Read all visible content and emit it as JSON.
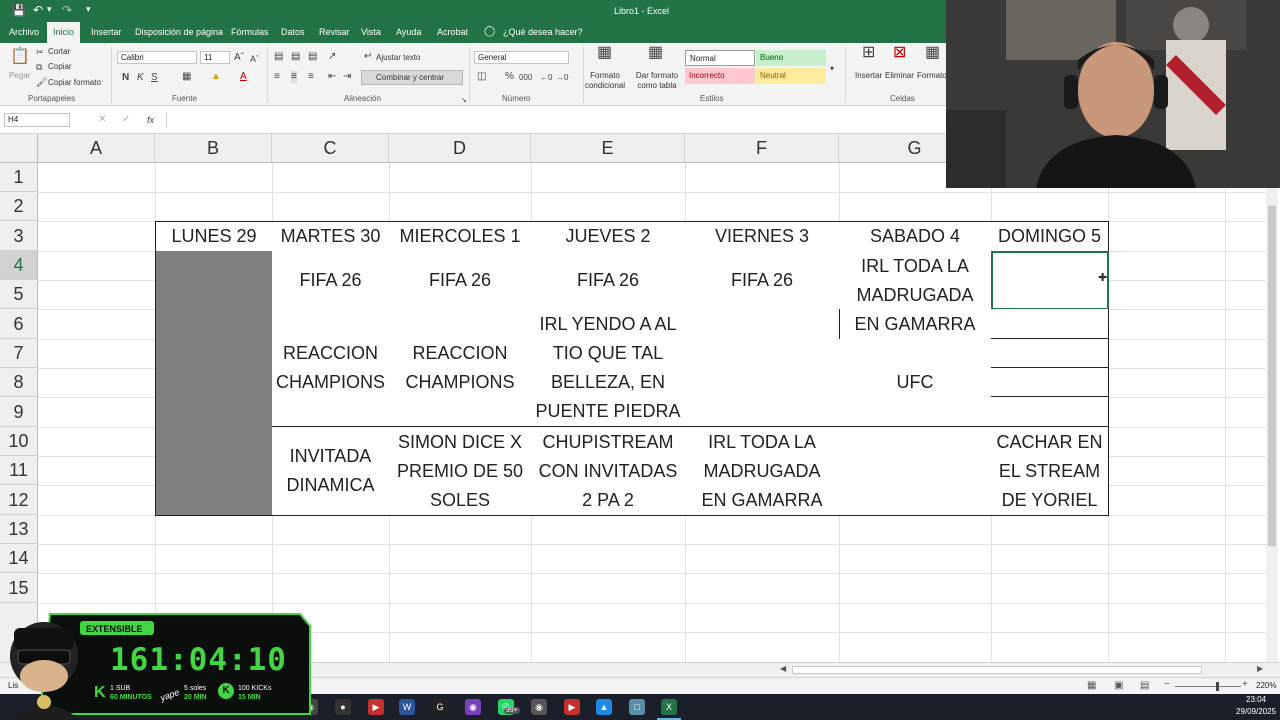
{
  "window": {
    "title": "Libro1 - Excel"
  },
  "ribbon_tabs": [
    "Archivo",
    "Inicio",
    "Insertar",
    "Disposición de página",
    "Fórmulas",
    "Datos",
    "Revisar",
    "Vista",
    "Ayuda",
    "Acrobat"
  ],
  "tell_me": "¿Qué desea hacer?",
  "clipboard": {
    "cut": "Cortar",
    "copy": "Copiar",
    "copy_format": "Copiar formato",
    "paste": "Pegar",
    "group": "Portapapeles"
  },
  "font": {
    "name": "Calibri",
    "size": "11",
    "group": "Fuente"
  },
  "alignment": {
    "wrap": "Ajustar texto",
    "merge": "Combinar y centrar",
    "group": "Alineación"
  },
  "number": {
    "format": "General",
    "group": "Número"
  },
  "styles": {
    "cond_format": "Formato\ncondicional",
    "as_table": "Dar formato\ncomo tabla",
    "normal": "Normal",
    "bueno": "Bueno",
    "incorrecto": "Incorrecto",
    "neutral": "Neutral",
    "group": "Estilos",
    "colors": {
      "bueno_bg": "#c6efce",
      "bueno_fg": "#006100",
      "incorrecto_bg": "#ffc7ce",
      "incorrecto_fg": "#9c0006",
      "neutral_bg": "#ffeb9c",
      "neutral_fg": "#9c5700"
    }
  },
  "cells_group": {
    "insert": "Insertar",
    "delete": "Eliminar",
    "format": "Formato",
    "group": "Celdas"
  },
  "formula_bar": {
    "name_box": "H4",
    "fx": "fx",
    "value": ""
  },
  "grid": {
    "columns": [
      "A",
      "B",
      "C",
      "D",
      "E",
      "F",
      "G"
    ],
    "rows": [
      "1",
      "2",
      "3",
      "4",
      "5",
      "6",
      "7",
      "8",
      "9",
      "10",
      "11",
      "12",
      "13",
      "14",
      "15"
    ],
    "headers": [
      "LUNES 29",
      "MARTES 30",
      "MIERCOLES 1",
      "JUEVES 2",
      "VIERNES 3",
      "SABADO 4",
      "DOMINGO 5"
    ],
    "cells": {
      "c_fifa": "FIFA 26",
      "d_fifa": "FIFA 26",
      "e_fifa": "FIFA 26",
      "f_fifa": "FIFA 26",
      "g_irl": "IRL TODA LA\nMADRUGADA\nEN GAMARRA",
      "c_reaccion": "REACCION\nCHAMPIONS",
      "d_reaccion": "REACCION\nCHAMPIONS",
      "e_irl": "IRL YENDO A AL\nTIO QUE TAL\nBELLEZA, EN\nPUENTE PIEDRA",
      "g_ufc": "UFC",
      "c_invitada": "INVITADA\nDINAMICA",
      "d_simon": "SIMON DICE X\nPREMIO DE 50\nSOLES",
      "e_chupi": "CHUPISTREAM\nCON INVITADAS\n2 PA 2",
      "f_irl": "IRL TODA LA\nMADRUGADA\nEN GAMARRA",
      "h_cachar": "CACHAR EN\nEL STREAM\nDE YORIEL"
    },
    "fill_gray": "#7f7f7f"
  },
  "status": {
    "left": "Lis",
    "zoom": "220%"
  },
  "taskbar": {
    "time": "23:04",
    "date": "29/09/2025",
    "badge": "99+"
  },
  "overlay": {
    "label": "EXTENSIBLE",
    "timer": "161:04:10",
    "rates": [
      {
        "top": "1 SUB",
        "bottom": "60 MINUTOS"
      },
      {
        "top": "5 soles",
        "bottom": "20 MIN"
      },
      {
        "top": "100 KICKs",
        "bottom": "15 MIN"
      }
    ],
    "yape_label": "yape"
  }
}
